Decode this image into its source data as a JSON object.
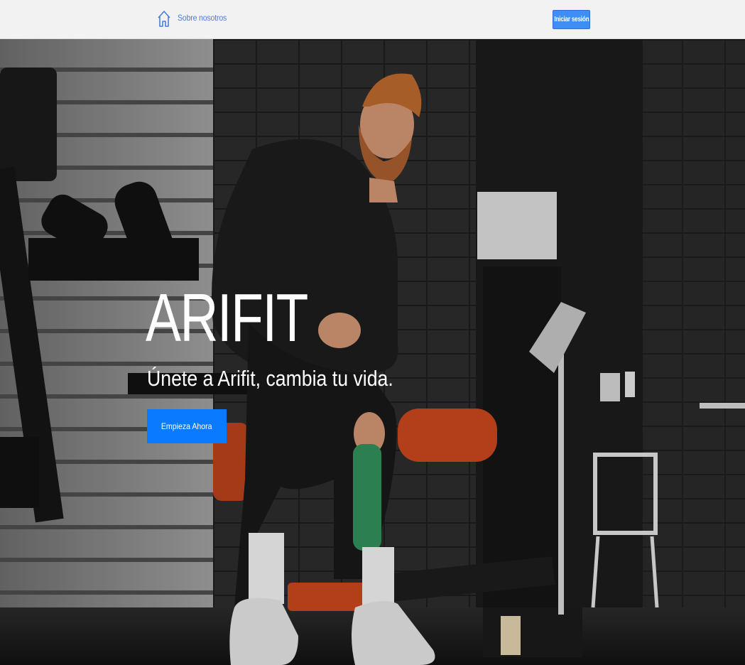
{
  "navbar": {
    "home_icon": "home-icon",
    "about_label": "Sobre nosotros",
    "login_label": "Iniciar sesión"
  },
  "hero": {
    "title": "ARIFIT",
    "subtitle": "Únete a Arifit, cambia tu vida.",
    "cta_label": "Empieza Ahora",
    "background": "gym-photo"
  },
  "colors": {
    "accent": "#0a7bff",
    "navbar_bg": "#f2f2f2",
    "link": "#4a7fd6"
  }
}
